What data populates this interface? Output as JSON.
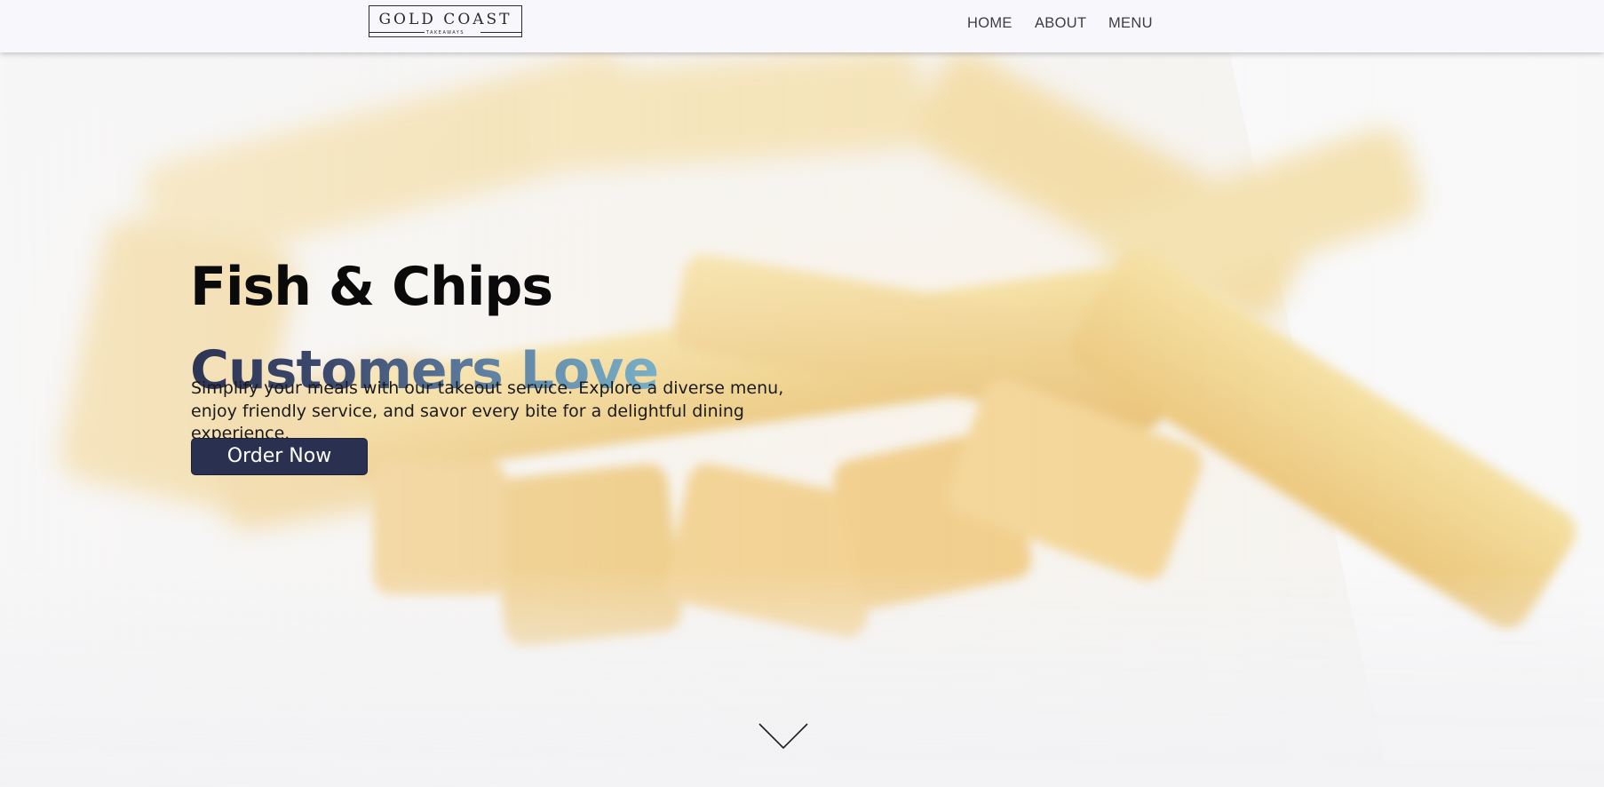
{
  "header": {
    "logo": {
      "title": "GOLD COAST",
      "subtitle": "TAKEAWAYS"
    },
    "nav": [
      {
        "label": "HOME"
      },
      {
        "label": "ABOUT"
      },
      {
        "label": "MENU"
      }
    ]
  },
  "hero": {
    "title_line1": "Fish & Chips",
    "title_line2": "Customers Love",
    "description": "Simplify your meals with our takeout service. Explore a diverse menu, enjoy friendly service, and savor every bite for a delightful dining experience.",
    "cta_label": "Order Now",
    "background": "fries-photo",
    "scroll_icon": "chevron-down-icon"
  },
  "colors": {
    "header_bg": "#f7f7fc",
    "cta_bg": "#2a3050",
    "gradient_start": "#2d3454",
    "gradient_end": "#78b0c6"
  }
}
